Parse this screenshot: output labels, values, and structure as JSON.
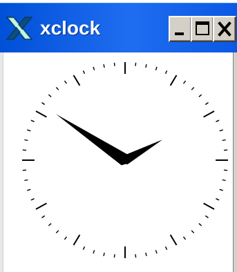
{
  "window": {
    "title": "xclock",
    "app_icon": "x-logo-icon"
  },
  "titlebar_buttons": {
    "minimize_icon": "minimize-icon",
    "maximize_icon": "maximize-icon",
    "close_icon": "close-icon"
  },
  "clock": {
    "hour": 10,
    "minute": 10,
    "hand_color": "#000000",
    "tick_color": "#000000",
    "face_color": "#ffffff"
  },
  "colors": {
    "titlebar": "#0050d8",
    "title_text": "#ffffff",
    "button_face": "#d4d0c8"
  }
}
